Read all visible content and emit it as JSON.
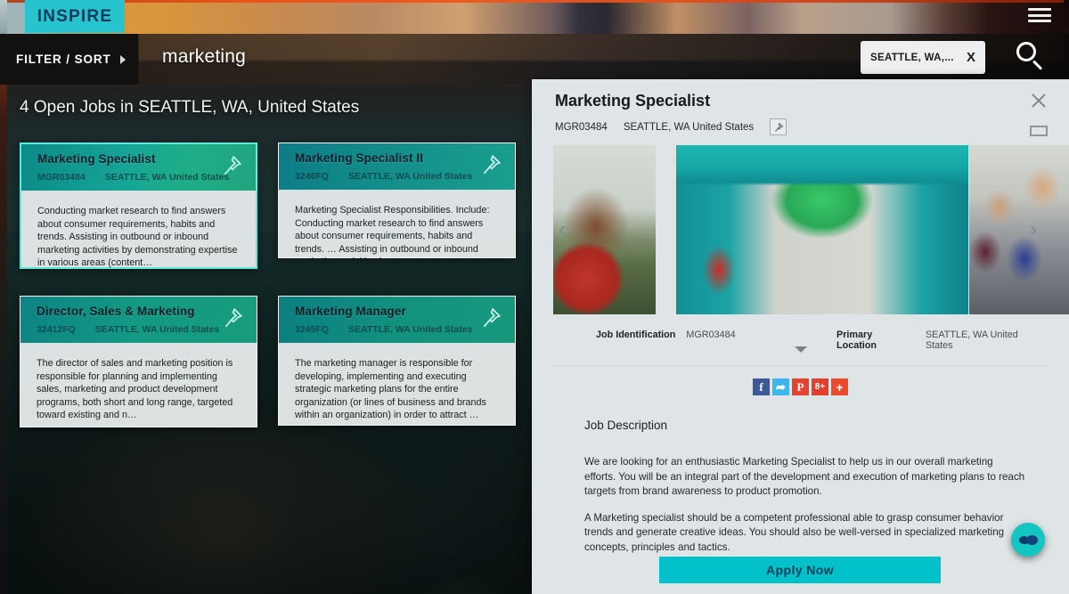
{
  "brand": {
    "logo_text": "INSPIRE"
  },
  "topbar": {
    "menu_icon": "hamburger-icon"
  },
  "nav": {
    "filter_sort_label": "FILTER / SORT",
    "query_term": "marketing",
    "search_chip_text": "SEATTLE, WA,...",
    "search_chip_clear": "X",
    "search_icon": "search-icon"
  },
  "results": {
    "heading": "4 Open Jobs in SEATTLE, WA, United States",
    "cards": [
      {
        "title": "Marketing Specialist",
        "id": "MGR03484",
        "location": "SEATTLE, WA United States",
        "description": "Conducting market research to find answers about consumer requirements, habits and trends. Assisting in outbound or inbound marketing activities by demonstrating expertise in various areas (content…",
        "pin_icon": "pin-icon",
        "selected": true
      },
      {
        "title": "Marketing Specialist II",
        "id": "3246FQ",
        "location": "SEATTLE, WA United States",
        "description": "Marketing Specialist Responsibilities. Include: Conducting market research to find answers about consumer requirements, habits and trends. … Assisting in outbound or inbound marketing activities by…",
        "pin_icon": "pin-icon",
        "selected": false
      },
      {
        "title": "Director, Sales & Marketing",
        "id": "32412FQ",
        "location": "SEATTLE, WA United States",
        "description": "The director of sales and marketing position is responsible for planning and implementing sales, marketing and product development programs, both short and long range, targeted toward existing and n…",
        "pin_icon": "pin-icon",
        "selected": false
      },
      {
        "title": "Marketing Manager",
        "id": "3249FQ",
        "location": "SEATTLE, WA United States",
        "description": "The marketing manager is responsible for developing, implementing and executing strategic marketing plans for the entire organization (or lines of business and brands within an organization) in order to attract …",
        "pin_icon": "pin-icon",
        "selected": false
      }
    ]
  },
  "detail": {
    "title": "Marketing Specialist",
    "id": "MGR03484",
    "location": "SEATTLE, WA United States",
    "pin_icon": "pin-icon",
    "close_icon": "close-icon",
    "window_icon": "window-icon",
    "carousel": {
      "prev_icon": "chevron-left-icon",
      "next_icon": "chevron-right-icon",
      "slides": [
        "woman-outdoors-photo",
        "office-atrium-photo",
        "team-meeting-photo"
      ]
    },
    "identification": {
      "job_id_label": "Job Identification",
      "job_id_value": "MGR03484",
      "location_label": "Primary Location",
      "location_value": "SEATTLE, WA United States",
      "expand_icon": "chevron-down-icon"
    },
    "social": [
      {
        "name": "facebook-share-icon",
        "glyph": "f",
        "color": "#3b5998"
      },
      {
        "name": "twitter-share-icon",
        "glyph": "❧",
        "color": "#3ab7ee"
      },
      {
        "name": "pinterest-share-icon",
        "glyph": "P",
        "color": "#e8412f"
      },
      {
        "name": "googleplus-share-icon",
        "glyph": "8+",
        "color": "#e0402c"
      },
      {
        "name": "more-share-icon",
        "glyph": "+",
        "color": "#ec4a2a"
      }
    ],
    "description_title": "Job Description",
    "description_paragraphs": [
      "We are looking for an enthusiastic Marketing Specialist to help us in our overall marketing efforts. You will be an integral part of the development and execution of marketing plans to reach targets from brand awareness to product promotion.",
      "A Marketing specialist should be a competent professional able to grasp consumer behavior trends and generate creative ideas. You should also be well-versed in specialized marketing concepts, principles and tactics."
    ],
    "apply_label": "Apply Now",
    "chat_icon": "chat-bubble-icon"
  },
  "colors": {
    "brand_teal": "#27c3cf",
    "card_header_teal": "#16a596",
    "apply_button": "#00c1c9",
    "panel_bg": "#dfe4e6",
    "selected_card_border": "#5fe8dd"
  }
}
